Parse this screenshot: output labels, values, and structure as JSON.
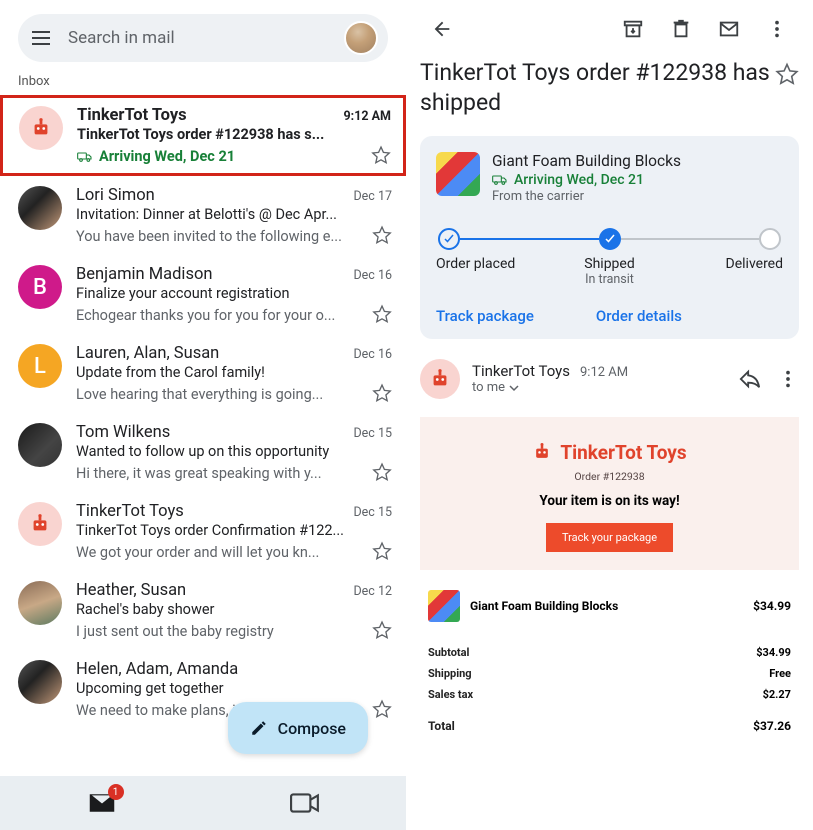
{
  "left": {
    "search_placeholder": "Search in mail",
    "folder": "Inbox",
    "emails": [
      {
        "sender": "TinkerTot Toys",
        "time": "9:12 AM",
        "subject": "TinkerTot Toys order #122938 has s...",
        "arriving": "Arriving Wed, Dec 21",
        "unread": true
      },
      {
        "sender": "Lori Simon",
        "time": "Dec 17",
        "subject": "Invitation: Dinner at Belotti's @ Dec Apr...",
        "snippet": "You have been invited to the following e..."
      },
      {
        "sender": "Benjamin Madison",
        "time": "Dec 16",
        "subject": "Finalize your account registration",
        "snippet": "Echogear thanks you for you for your o...",
        "initial": "B"
      },
      {
        "sender": "Lauren, Alan, Susan",
        "time": "Dec 16",
        "subject": "Update from the Carol family!",
        "snippet": "Love hearing that everything is going...",
        "initial": "L"
      },
      {
        "sender": "Tom Wilkens",
        "time": "Dec 15",
        "subject": "Wanted to follow up on this opportunity",
        "snippet": "Hi there, it was great speaking with y..."
      },
      {
        "sender": "TinkerTot Toys",
        "time": "Dec 15",
        "subject": "TinkerTot Toys order Confirmation #122...",
        "snippet": "We got your order and will let you kn..."
      },
      {
        "sender": "Heather, Susan",
        "time": "Dec 12",
        "subject": "Rachel's baby shower",
        "snippet": "I just sent out the baby registry"
      },
      {
        "sender": "Helen, Adam, Amanda",
        "time": "",
        "subject": "Upcoming get together",
        "snippet": "We need to make plans, it's been too..."
      }
    ],
    "compose": "Compose",
    "badge": "1"
  },
  "right": {
    "title": "TinkerTot Toys order #122938 has shipped",
    "card": {
      "product": "Giant Foam Building Blocks",
      "arriving": "Arriving Wed, Dec 21",
      "from": "From the carrier",
      "stage1": "Order placed",
      "stage2": "Shipped",
      "stage2sub": "In transit",
      "stage3": "Delivered",
      "link1": "Track package",
      "link2": "Order details"
    },
    "msg": {
      "sender": "TinkerTot Toys",
      "time": "9:12 AM",
      "to": "to me"
    },
    "brand": {
      "name": "TinkerTot Toys",
      "order": "Order #122938",
      "onway": "Your item is on its way!",
      "track": "Track your package"
    },
    "order": {
      "item": "Giant Foam Building Blocks",
      "item_price": "$34.99",
      "subtotal_l": "Subtotal",
      "subtotal_v": "$34.99",
      "shipping_l": "Shipping",
      "shipping_v": "Free",
      "tax_l": "Sales tax",
      "tax_v": "$2.27",
      "total_l": "Total",
      "total_v": "$37.26"
    }
  }
}
